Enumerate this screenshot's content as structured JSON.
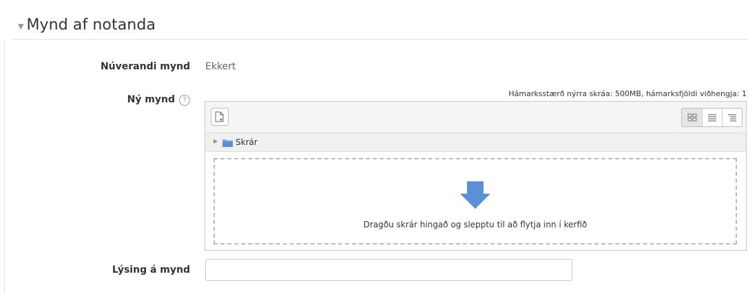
{
  "section": {
    "title": "Mynd af notanda"
  },
  "current_picture": {
    "label": "Núverandi mynd",
    "value": "Ekkert"
  },
  "new_picture": {
    "label": "Ný mynd",
    "help_icon": "help-circle-icon",
    "max_info": "Hámarksstærð nýrra skráa: 500MB, hámarksfjöldi viðhengja: 1",
    "toolbar": {
      "add_icon": "file-add-icon",
      "views": [
        "icons-view-icon",
        "list-view-icon",
        "tree-view-icon"
      ]
    },
    "path": {
      "folder_icon": "folder-icon",
      "label": "Skrár"
    },
    "dropzone": {
      "arrow_icon": "arrow-down-icon",
      "text": "Dragðu skrár hingað og slepptu til að flytja inn í kerfið"
    }
  },
  "description": {
    "label": "Lýsing á mynd",
    "value": ""
  },
  "colors": {
    "arrow": "#5b8fd6",
    "folder": "#7aa7de"
  }
}
